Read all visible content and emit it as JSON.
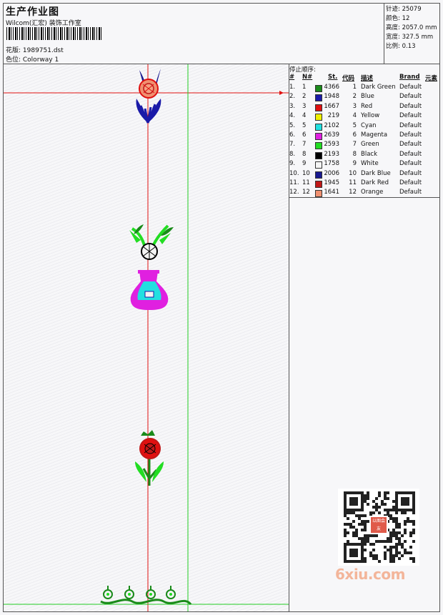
{
  "header": {
    "title": "生产作业图",
    "company": "Wilcom(汇宏) 装饰工作室",
    "design_file": "花版:  1989751.dst",
    "colorway": "色位:  Colorway 1"
  },
  "stats": [
    {
      "label": "针迹:",
      "value": "25079"
    },
    {
      "label": "颜色:",
      "value": "12"
    },
    {
      "label": "高度:",
      "value": "2057.0 mm"
    },
    {
      "label": "宽度:",
      "value": "327.5 mm"
    },
    {
      "label": "比例:",
      "value": "0.13"
    }
  ],
  "stop_sequence_label": "停止顺序:",
  "table": {
    "headers": [
      "#",
      "N#",
      "St.",
      "代码",
      "描述",
      "Brand",
      "元素"
    ],
    "rows": [
      {
        "idx": "1.",
        "n": "1",
        "color": "#1a8a1a",
        "st": "4366",
        "code": "1",
        "desc": "Dark Green",
        "brand": "Default"
      },
      {
        "idx": "2.",
        "n": "2",
        "color": "#1a1aa8",
        "st": "1948",
        "code": "2",
        "desc": "Blue",
        "brand": "Default"
      },
      {
        "idx": "3.",
        "n": "3",
        "color": "#e01010",
        "st": "1667",
        "code": "3",
        "desc": "Red",
        "brand": "Default"
      },
      {
        "idx": "4.",
        "n": "4",
        "color": "#f0f000",
        "st": "219",
        "code": "4",
        "desc": "Yellow",
        "brand": "Default"
      },
      {
        "idx": "5.",
        "n": "5",
        "color": "#22e0e0",
        "st": "2102",
        "code": "5",
        "desc": "Cyan",
        "brand": "Default"
      },
      {
        "idx": "6.",
        "n": "6",
        "color": "#e020e0",
        "st": "2639",
        "code": "6",
        "desc": "Magenta",
        "brand": "Default"
      },
      {
        "idx": "7.",
        "n": "7",
        "color": "#22dd22",
        "st": "2593",
        "code": "7",
        "desc": "Green",
        "brand": "Default"
      },
      {
        "idx": "8.",
        "n": "8",
        "color": "#000000",
        "st": "2193",
        "code": "8",
        "desc": "Black",
        "brand": "Default"
      },
      {
        "idx": "9.",
        "n": "9",
        "color": "#f4f4f4",
        "st": "1758",
        "code": "9",
        "desc": "White",
        "brand": "Default"
      },
      {
        "idx": "10.",
        "n": "10",
        "color": "#1a1a90",
        "st": "2006",
        "code": "10",
        "desc": "Dark Blue",
        "brand": "Default"
      },
      {
        "idx": "11.",
        "n": "11",
        "color": "#c01818",
        "st": "1945",
        "code": "11",
        "desc": "Dark Red",
        "brand": "Default"
      },
      {
        "idx": "12.",
        "n": "12",
        "color": "#f09070",
        "st": "1641",
        "code": "12",
        "desc": "Orange",
        "brand": "Default"
      }
    ]
  },
  "watermark": {
    "text": "6xiu.com",
    "seal_text": "以图会友"
  }
}
